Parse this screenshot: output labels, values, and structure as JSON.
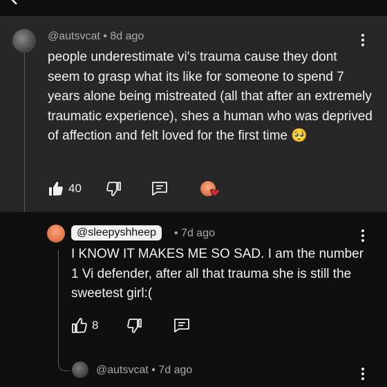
{
  "comment": {
    "author": "@autsvcat",
    "time": "8d ago",
    "text": "people underestimate vi's trauma cause they dont seem to grasp what its like for someone to spend 7 years alone being mistreated (all that after an extremely traumatic experience), shes a human who was deprived of affection and felt loved for the first time 🥺",
    "likes": "40",
    "icons": {
      "like": "thumb-up-icon",
      "dislike": "thumb-down-icon",
      "reply": "reply-icon",
      "creator_heart": "creator-heart-icon",
      "more": "kebab-menu-icon"
    }
  },
  "reply": {
    "author": "@sleepyshheep",
    "time": "7d ago",
    "text": "I KNOW IT MAKES ME SO SAD. I am the number 1 Vi defender, after all that trauma she is still the sweetest girl:(",
    "likes": "8"
  },
  "nested_reply": {
    "author": "@autsvcat",
    "time": "7d ago"
  },
  "separator": "•"
}
